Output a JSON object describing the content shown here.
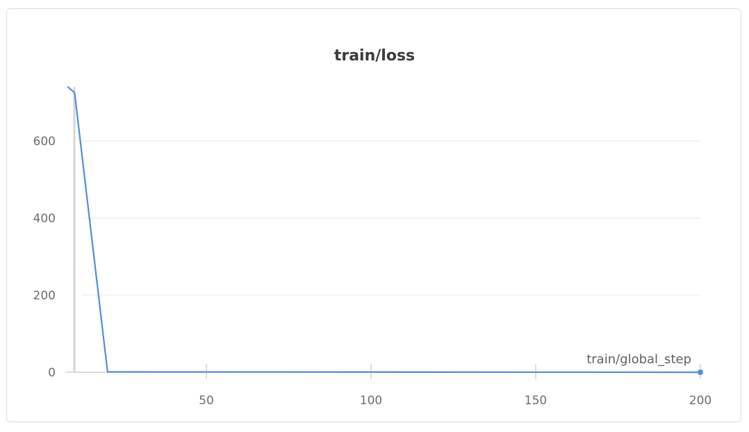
{
  "chart_data": {
    "type": "line",
    "title": "train/loss",
    "xlabel": "train/global_step",
    "ylabel": "",
    "x_ticks": [
      50,
      100,
      150,
      200
    ],
    "y_ticks": [
      0,
      200,
      400,
      600
    ],
    "xlim": [
      7,
      200
    ],
    "ylim": [
      0,
      740
    ],
    "grid": true,
    "series": [
      {
        "color": "#4a90d9",
        "x": [
          8,
          10,
          20,
          200
        ],
        "y": [
          740,
          725,
          1,
          0
        ]
      }
    ]
  }
}
